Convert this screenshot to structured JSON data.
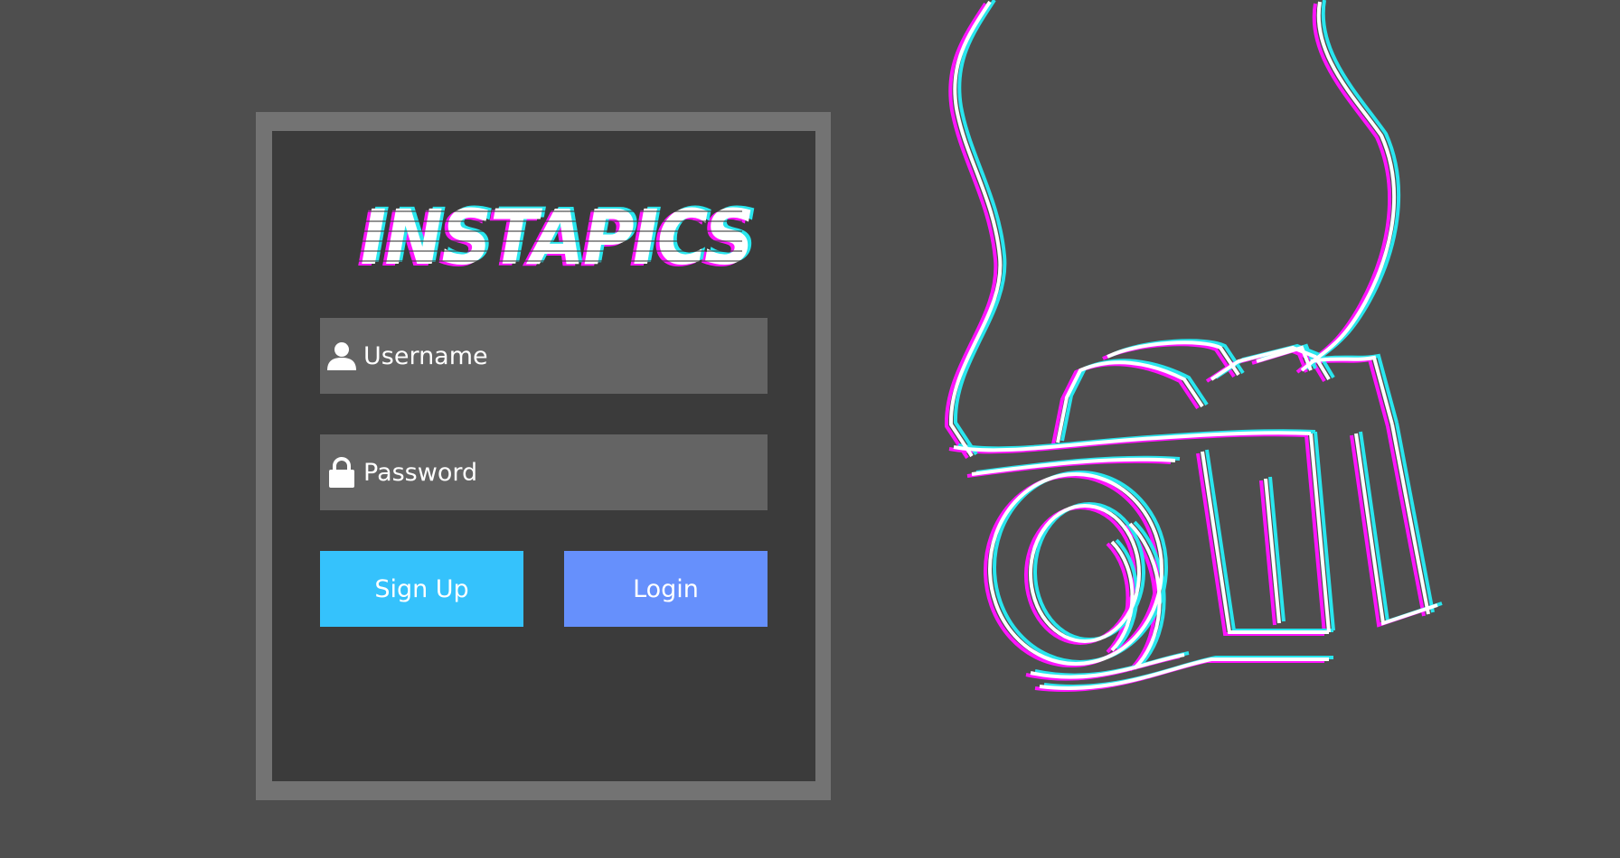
{
  "app": {
    "logo_text": "INSTAPICS"
  },
  "login_form": {
    "username": {
      "placeholder": "Username",
      "value": "",
      "icon": "user-icon"
    },
    "password": {
      "placeholder": "Password",
      "value": "",
      "icon": "lock-icon"
    },
    "signup_label": "Sign Up",
    "login_label": "Login"
  },
  "colors": {
    "page_bg": "#4e4e4e",
    "frame": "#737373",
    "card": "#3b3b3b",
    "input_bg": "#646464",
    "signup_button": "#35c2fc",
    "login_button": "#6690fc",
    "glitch_magenta": "#ff14ff",
    "glitch_cyan": "#29e6ee"
  },
  "illustration": {
    "icon": "camera-icon"
  }
}
